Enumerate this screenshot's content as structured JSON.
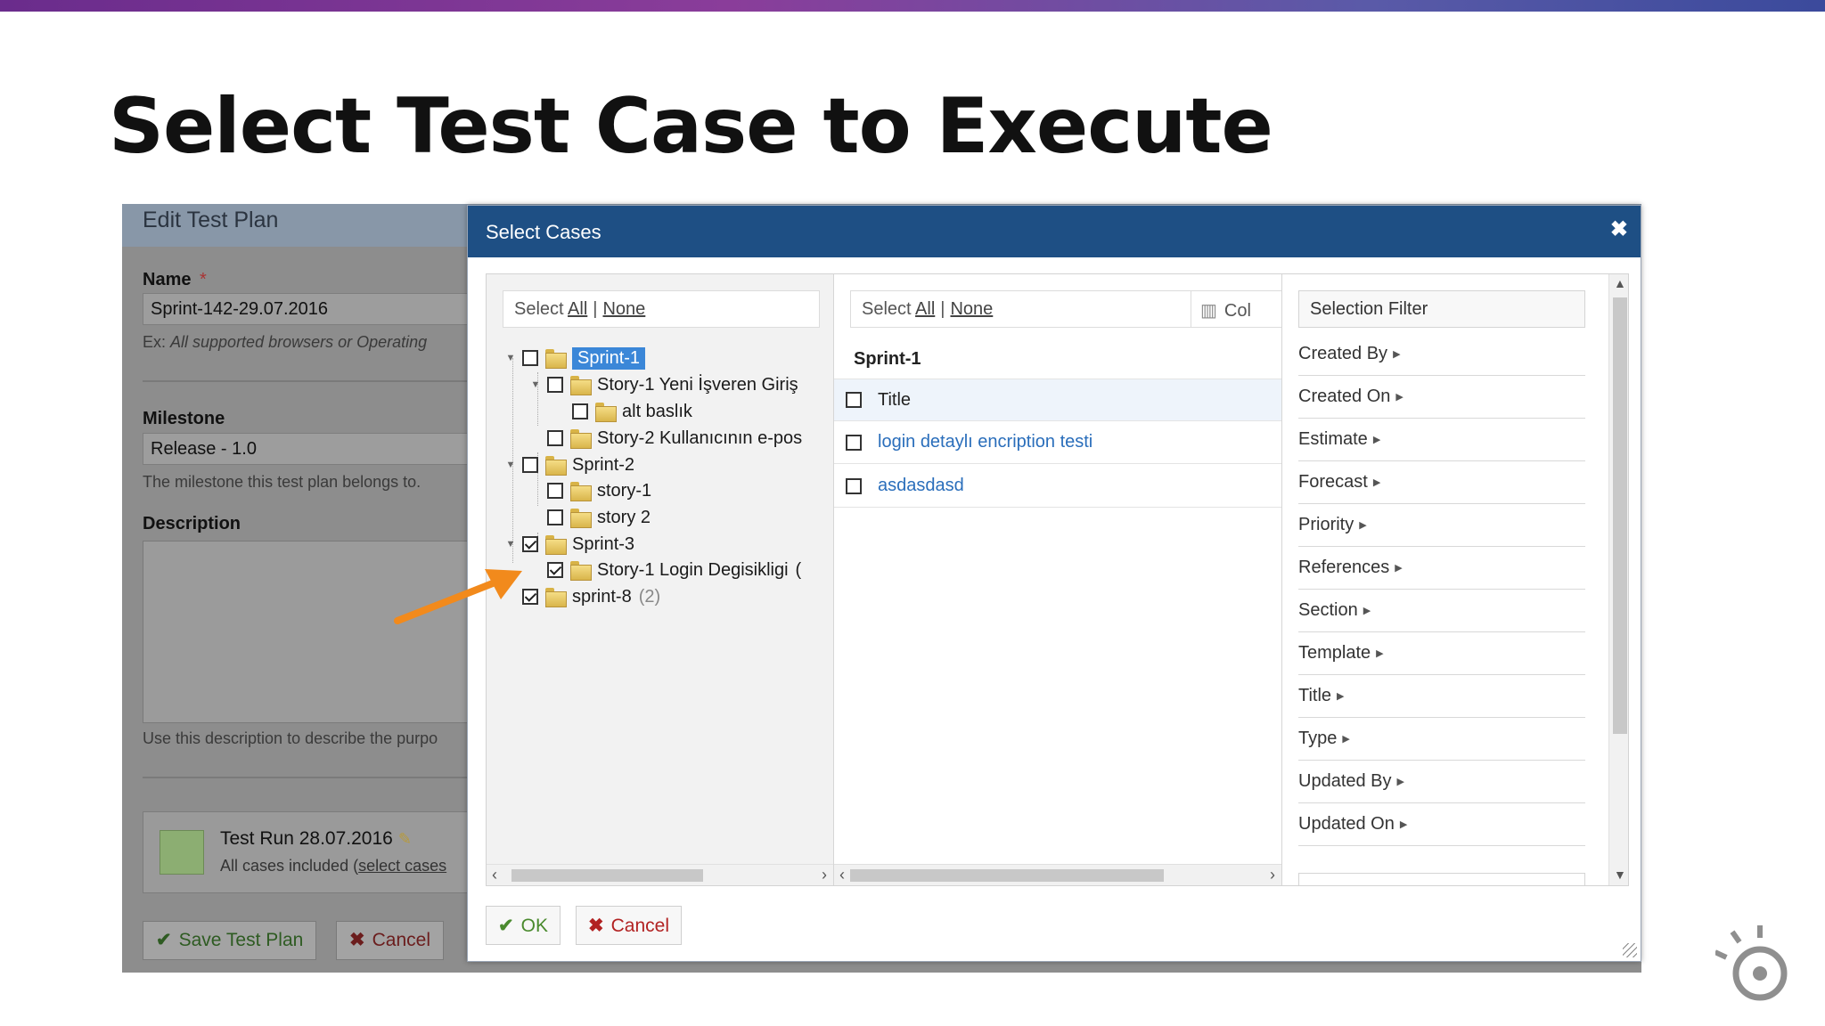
{
  "slide": {
    "title": "Select Test Case to Execute"
  },
  "edit_plan": {
    "header": "Edit Test Plan",
    "name_label": "Name",
    "required_mark": "*",
    "name_value": "Sprint-142-29.07.2016",
    "name_hint_prefix": "Ex: ",
    "name_hint": "All supported browsers or Operating",
    "milestone_label": "Milestone",
    "milestone_value": "Release - 1.0",
    "milestone_hint": "The milestone this test plan belongs to.",
    "description_label": "Description",
    "description_hint": "Use this description to describe the purpo",
    "run_title": "Test Run 28.07.2016",
    "run_sub_prefix": "All cases included (",
    "run_sub_link": "select cases",
    "save_button": "Save Test Plan",
    "cancel_button": "Cancel",
    "colors": {
      "run_swatch": "#8cae72"
    }
  },
  "modal": {
    "title": "Select Cases",
    "close_icon": "close-icon",
    "tree_select": {
      "prefix": "Select",
      "all": "All",
      "separator": "|",
      "none": "None"
    },
    "tree": [
      {
        "label": "Sprint-1",
        "checked": false,
        "selected": true
      },
      {
        "label": "Story-1 Yeni İşveren Giriş",
        "checked": false
      },
      {
        "label": "alt baslık",
        "checked": false
      },
      {
        "label": "Story-2 Kullanıcının e-pos",
        "checked": false
      },
      {
        "label": "Sprint-2",
        "checked": false
      },
      {
        "label": "story-1",
        "checked": false
      },
      {
        "label": "story 2",
        "checked": false
      },
      {
        "label": "Sprint-3",
        "checked": true
      },
      {
        "label": "Story-1 Login Degisikligi",
        "checked": true,
        "suffix": "("
      },
      {
        "label": "sprint-8",
        "checked": true,
        "count": "(2)"
      }
    ],
    "cases_select": {
      "prefix": "Select",
      "all": "All",
      "separator": "|",
      "none": "None"
    },
    "columns_label": "Col",
    "cases_group": "Sprint-1",
    "cases_header": "Title",
    "cases": [
      {
        "title": "login detaylı encription testi"
      },
      {
        "title": "asdasdasd"
      }
    ],
    "filter_title": "Selection Filter",
    "filters": [
      "Created By",
      "Created On",
      "Estimate",
      "Forecast",
      "Priority",
      "References",
      "Section",
      "Template",
      "Title",
      "Type",
      "Updated By",
      "Updated On"
    ],
    "ok_button": "OK",
    "cancel_button": "Cancel",
    "colors": {
      "header": "#1e4f84",
      "selected": "#3b87d8",
      "link": "#2a6ebb"
    }
  },
  "annotation": {
    "arrow_color": "#f28a1c"
  },
  "logo": {
    "icon": "logo-icon"
  }
}
